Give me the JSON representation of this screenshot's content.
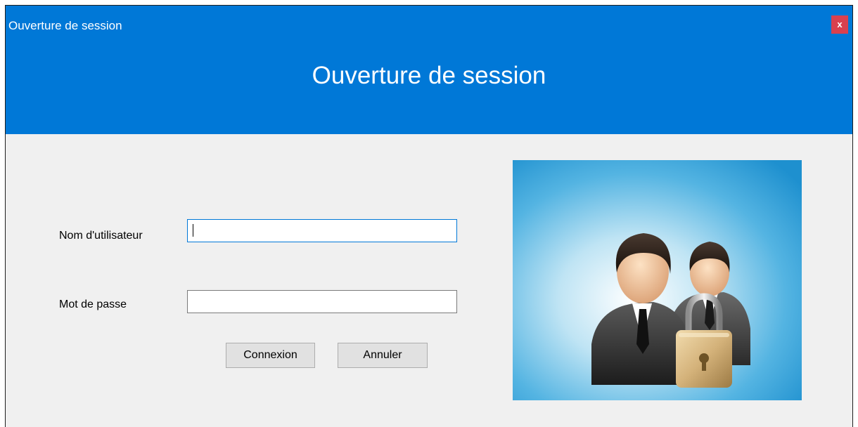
{
  "window": {
    "title": "Ouverture de session",
    "close_label": "x"
  },
  "header": {
    "heading": "Ouverture de session"
  },
  "form": {
    "username_label": "Nom d'utilisateur",
    "username_value": "",
    "password_label": "Mot de passe",
    "password_value": ""
  },
  "buttons": {
    "connect_label": "Connexion",
    "cancel_label": "Annuler"
  },
  "illustration": {
    "icon": "users-lock-icon"
  },
  "colors": {
    "accent": "#0078d7",
    "window_background": "#f0f0f0",
    "close_button": "#d9404e",
    "illustration_background": "#2fa3dc"
  }
}
